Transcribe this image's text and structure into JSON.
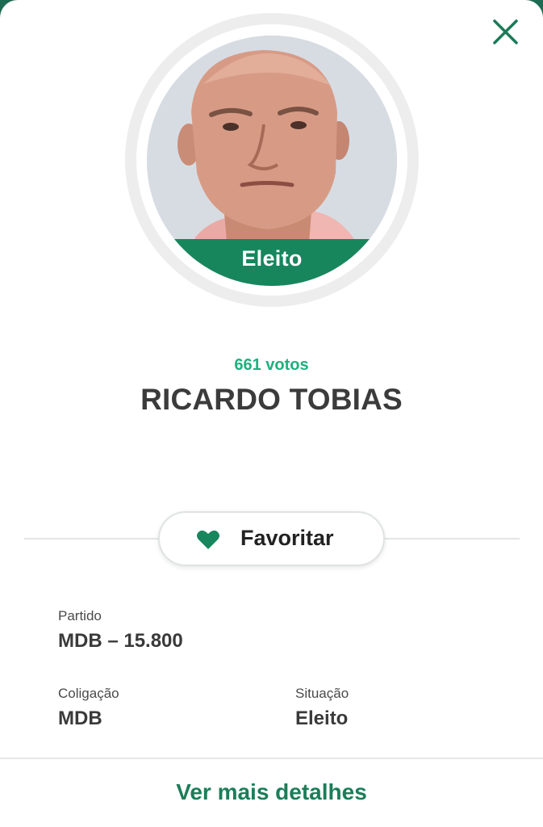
{
  "candidate": {
    "status_badge": "Eleito",
    "votes": "661 votos",
    "name": "RICARDO TOBIAS"
  },
  "actions": {
    "favorite_label": "Favoritar",
    "favorite_icon": "heart-icon",
    "close_icon": "close-icon",
    "more_details_label": "Ver mais detalhes"
  },
  "details": {
    "party": {
      "label": "Partido",
      "value": "MDB – 15.800"
    },
    "coalition": {
      "label": "Coligação",
      "value": "MDB"
    },
    "situation": {
      "label": "Situação",
      "value": "Eleito"
    }
  },
  "colors": {
    "primary_green": "#17865d",
    "votes_green": "#1fb07d",
    "link_green": "#1c7d59"
  }
}
